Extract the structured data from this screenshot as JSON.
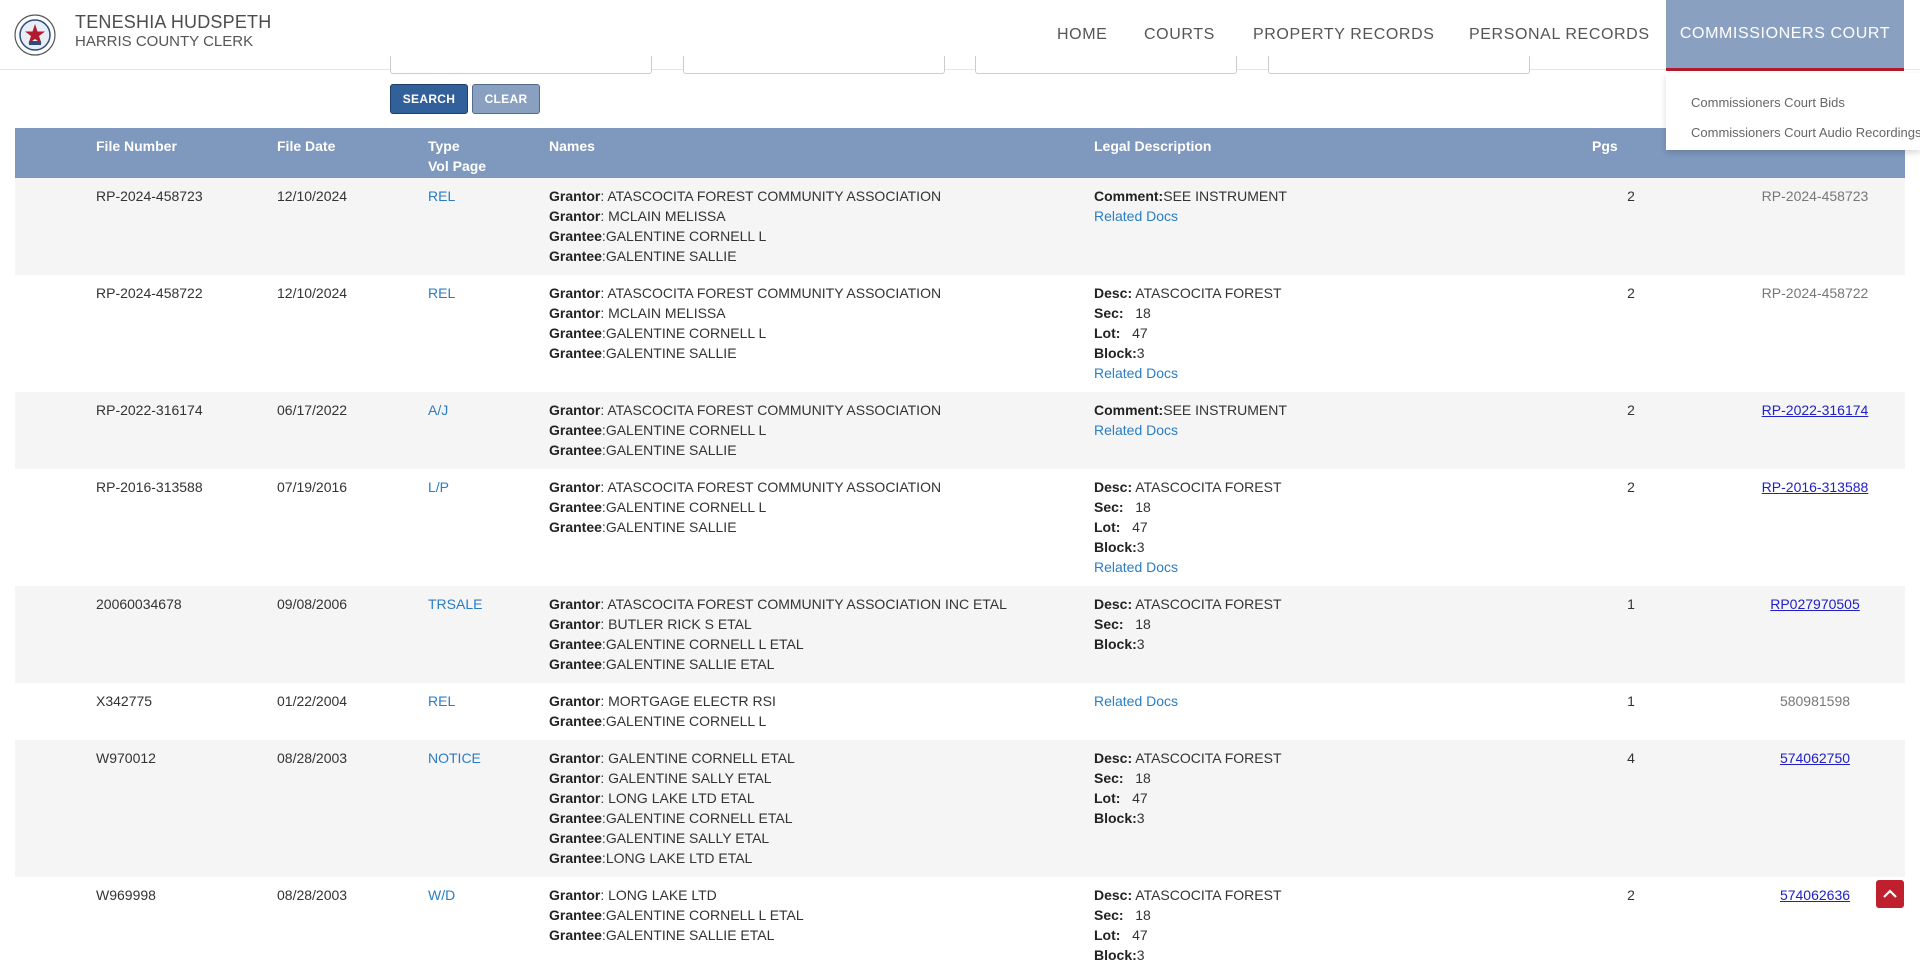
{
  "header": {
    "clerk_name": "TENESHIA HUDSPETH",
    "clerk_title": "HARRIS COUNTY CLERK",
    "nav": {
      "home": "HOME",
      "courts": "COURTS",
      "property": "PROPERTY RECORDS",
      "personal": "PERSONAL RECORDS",
      "commissioners": "COMMISSIONERS COURT"
    },
    "dropdown": {
      "bids": "Commissioners Court Bids",
      "audio": "Commissioners Court Audio Recordings"
    }
  },
  "search": {
    "search_label": "SEARCH",
    "clear_label": "CLEAR"
  },
  "table": {
    "headers": {
      "file_number": "File Number",
      "file_date": "File Date",
      "type": "Type",
      "vol_page": "Vol Page",
      "names": "Names",
      "legal": "Legal Description",
      "pgs": "Pgs"
    },
    "rows": [
      {
        "file": "RP-2024-458723",
        "date": "12/10/2024",
        "type": "REL",
        "names": [
          [
            "Grantor",
            "ATASCOCITA FOREST COMMUNITY ASSOCIATION"
          ],
          [
            "Grantor",
            "MCLAIN MELISSA"
          ],
          [
            "Grantee",
            "GALENTINE CORNELL L"
          ],
          [
            "Grantee",
            "GALENTINE SALLIE"
          ]
        ],
        "legal": [
          [
            "Comment:",
            "SEE INSTRUMENT"
          ]
        ],
        "related": "Related Docs",
        "pgs": "2",
        "film": "RP-2024-458723",
        "film_link": false
      },
      {
        "file": "RP-2024-458722",
        "date": "12/10/2024",
        "type": "REL",
        "names": [
          [
            "Grantor",
            "ATASCOCITA FOREST COMMUNITY ASSOCIATION"
          ],
          [
            "Grantor",
            "MCLAIN MELISSA"
          ],
          [
            "Grantee",
            "GALENTINE CORNELL L"
          ],
          [
            "Grantee",
            "GALENTINE SALLIE"
          ]
        ],
        "legal": [
          [
            "Desc:",
            "ATASCOCITA FOREST"
          ],
          [
            "Sec:",
            "18"
          ],
          [
            "Lot:",
            "47"
          ],
          [
            "Block:",
            "3"
          ]
        ],
        "related": "Related Docs",
        "pgs": "2",
        "film": "RP-2024-458722",
        "film_link": false
      },
      {
        "file": "RP-2022-316174",
        "date": "06/17/2022",
        "type": "A/J",
        "names": [
          [
            "Grantor",
            "ATASCOCITA FOREST COMMUNITY ASSOCIATION"
          ],
          [
            "Grantee",
            "GALENTINE CORNELL L"
          ],
          [
            "Grantee",
            "GALENTINE SALLIE"
          ]
        ],
        "legal": [
          [
            "Comment:",
            "SEE INSTRUMENT"
          ]
        ],
        "related": "Related Docs",
        "pgs": "2",
        "film": "RP-2022-316174",
        "film_link": true
      },
      {
        "file": "RP-2016-313588",
        "date": "07/19/2016",
        "type": "L/P",
        "names": [
          [
            "Grantor",
            "ATASCOCITA FOREST COMMUNITY ASSOCIATION"
          ],
          [
            "Grantee",
            "GALENTINE CORNELL L"
          ],
          [
            "Grantee",
            "GALENTINE SALLIE"
          ]
        ],
        "legal": [
          [
            "Desc:",
            "ATASCOCITA FOREST"
          ],
          [
            "Sec:",
            "18"
          ],
          [
            "Lot:",
            "47"
          ],
          [
            "Block:",
            "3"
          ]
        ],
        "related": "Related Docs",
        "pgs": "2",
        "film": "RP-2016-313588",
        "film_link": true
      },
      {
        "file": "20060034678",
        "date": "09/08/2006",
        "type": "TRSALE",
        "names": [
          [
            "Grantor",
            "ATASCOCITA FOREST COMMUNITY ASSOCIATION INC ETAL"
          ],
          [
            "Grantor",
            "BUTLER RICK S ETAL"
          ],
          [
            "Grantee",
            "GALENTINE CORNELL L ETAL"
          ],
          [
            "Grantee",
            "GALENTINE SALLIE ETAL"
          ]
        ],
        "legal": [
          [
            "Desc:",
            "ATASCOCITA FOREST"
          ],
          [
            "Sec:",
            "18"
          ],
          [
            "Block:",
            "3"
          ]
        ],
        "related": "",
        "pgs": "1",
        "film": "RP027970505",
        "film_link": true
      },
      {
        "file": "X342775",
        "date": "01/22/2004",
        "type": "REL",
        "names": [
          [
            "Grantor",
            "MORTGAGE ELECTR RSI"
          ],
          [
            "Grantee",
            "GALENTINE CORNELL L"
          ]
        ],
        "legal": [],
        "related": "Related Docs",
        "pgs": "1",
        "film": "580981598",
        "film_link": false
      },
      {
        "file": "W970012",
        "date": "08/28/2003",
        "type": "NOTICE",
        "names": [
          [
            "Grantor",
            "GALENTINE CORNELL ETAL"
          ],
          [
            "Grantor",
            "GALENTINE SALLY ETAL"
          ],
          [
            "Grantor",
            "LONG LAKE LTD ETAL"
          ],
          [
            "Grantee",
            "GALENTINE CORNELL ETAL"
          ],
          [
            "Grantee",
            "GALENTINE SALLY ETAL"
          ],
          [
            "Grantee",
            "LONG LAKE LTD ETAL"
          ]
        ],
        "legal": [
          [
            "Desc:",
            "ATASCOCITA FOREST"
          ],
          [
            "Sec:",
            "18"
          ],
          [
            "Lot:",
            "47"
          ],
          [
            "Block:",
            "3"
          ]
        ],
        "related": "",
        "pgs": "4",
        "film": "574062750",
        "film_link": true
      },
      {
        "file": "W969998",
        "date": "08/28/2003",
        "type": "W/D",
        "names": [
          [
            "Grantor",
            "LONG LAKE LTD"
          ],
          [
            "Grantee",
            "GALENTINE CORNELL L ETAL"
          ],
          [
            "Grantee",
            "GALENTINE SALLIE ETAL"
          ]
        ],
        "legal": [
          [
            "Desc:",
            "ATASCOCITA FOREST"
          ],
          [
            "Sec:",
            "18"
          ],
          [
            "Lot:",
            "47"
          ],
          [
            "Block:",
            "3"
          ]
        ],
        "related": "",
        "pgs": "2",
        "film": "574062636",
        "film_link": true
      }
    ]
  },
  "colors": {
    "accent": "#7f98bd",
    "nav_active": "#8aa0c0",
    "link": "#2a7dc4",
    "red": "#b01c2e"
  }
}
